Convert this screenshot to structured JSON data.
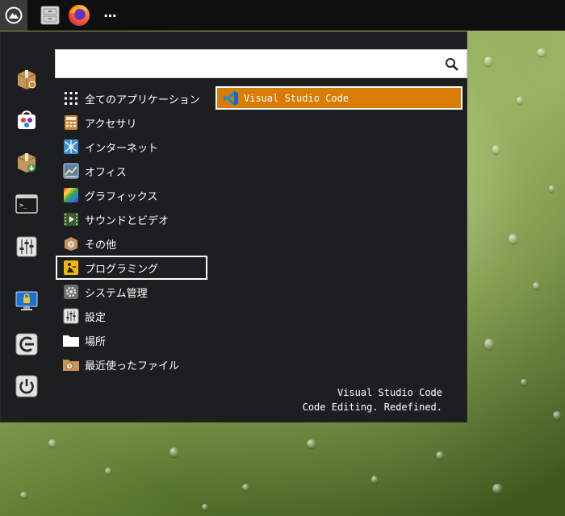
{
  "panel": {
    "launchers": [
      {
        "name": "menu-button",
        "icon": "cinnamon-menu-icon"
      },
      {
        "name": "files-launcher",
        "icon": "file-cabinet-icon"
      },
      {
        "name": "firefox-launcher",
        "icon": "firefox-icon"
      },
      {
        "name": "more-launcher",
        "icon": "more-icon",
        "label": "⋯"
      }
    ]
  },
  "sidebar": {
    "items": [
      {
        "name": "package-installer",
        "icon": "package-icon"
      },
      {
        "name": "software-center",
        "icon": "shopping-bag-icon"
      },
      {
        "name": "package-download",
        "icon": "package-download-icon"
      },
      {
        "name": "terminal",
        "icon": "terminal-icon",
        "label": ">_"
      },
      {
        "name": "settings-sliders",
        "icon": "sliders-icon"
      },
      {
        "name": "lock-screen",
        "icon": "lock-screen-icon"
      },
      {
        "name": "logout",
        "icon": "logout-icon"
      },
      {
        "name": "shutdown",
        "icon": "power-icon"
      }
    ]
  },
  "search": {
    "value": "",
    "placeholder": ""
  },
  "categories": [
    {
      "label": "全てのアプリケーション",
      "icon": "grid-icon"
    },
    {
      "label": "アクセサリ",
      "icon": "calculator-icon"
    },
    {
      "label": "インターネット",
      "icon": "network-icon"
    },
    {
      "label": "オフィス",
      "icon": "office-chart-icon"
    },
    {
      "label": "グラフィックス",
      "icon": "color-palette-icon"
    },
    {
      "label": "サウンドとビデオ",
      "icon": "multimedia-icon"
    },
    {
      "label": "その他",
      "icon": "other-box-icon"
    },
    {
      "label": "プログラミング",
      "icon": "construction-sign-icon"
    },
    {
      "label": "システム管理",
      "icon": "system-gear-icon"
    },
    {
      "label": "設定",
      "icon": "settings-sliders-icon"
    },
    {
      "label": "場所",
      "icon": "folder-icon"
    },
    {
      "label": "最近使ったファイル",
      "icon": "recent-files-icon"
    }
  ],
  "selected_category": "プログラミング",
  "apps": [
    {
      "label": "Visual Studio Code",
      "icon": "vscode-icon"
    }
  ],
  "description": {
    "title": "Visual Studio Code",
    "text": "Code Editing. Redefined."
  },
  "colors": {
    "menu_bg": "#1d1e20",
    "panel_bg": "#0f0f0f",
    "highlight": "#d97c05",
    "text": "#ffffff"
  }
}
